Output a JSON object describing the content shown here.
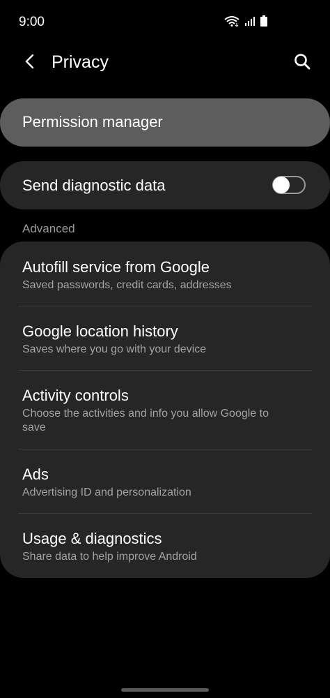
{
  "status": {
    "time": "9:00"
  },
  "header": {
    "title": "Privacy"
  },
  "permission_manager": {
    "label": "Permission manager"
  },
  "diagnostic": {
    "label": "Send diagnostic data",
    "enabled": false
  },
  "advanced": {
    "label": "Advanced",
    "items": [
      {
        "title": "Autofill service from Google",
        "subtitle": "Saved passwords, credit cards, addresses"
      },
      {
        "title": "Google location history",
        "subtitle": "Saves where you go with your device"
      },
      {
        "title": "Activity controls",
        "subtitle": "Choose the activities and info you allow Google to save"
      },
      {
        "title": "Ads",
        "subtitle": "Advertising ID and personalization"
      },
      {
        "title": "Usage & diagnostics",
        "subtitle": "Share data to help improve Android"
      }
    ]
  },
  "icons": {
    "back": "chevron-left-icon",
    "search": "search-icon",
    "wifi": "wifi-icon",
    "signal": "signal-icon",
    "battery": "battery-icon"
  },
  "colors": {
    "background": "#000000",
    "card": "#262626",
    "highlight_card": "#5d5d5d",
    "secondary_text": "#a3a3a3"
  }
}
